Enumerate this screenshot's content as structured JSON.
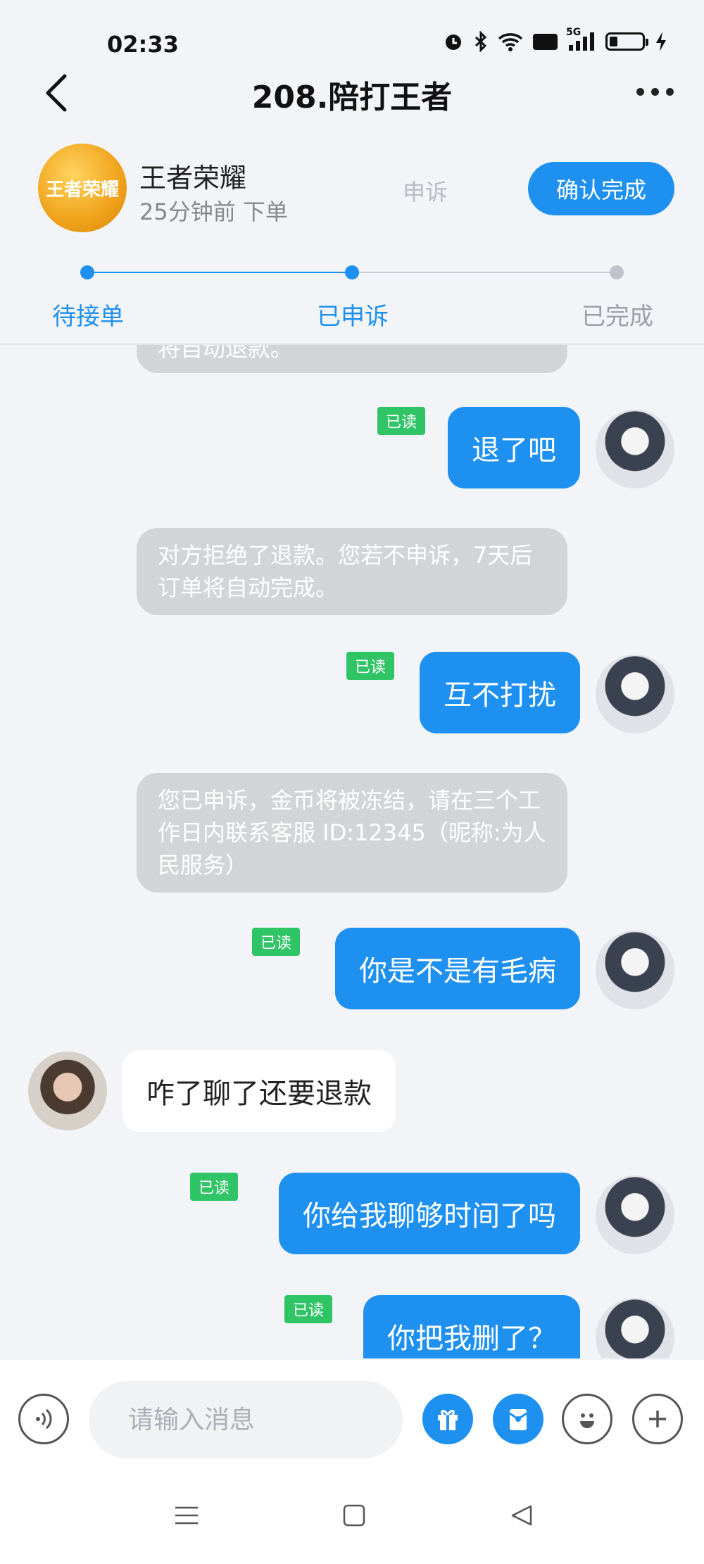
{
  "status_bar": {
    "time": "02:33",
    "icons": [
      "alarm-icon",
      "bluetooth-icon",
      "wifi-icon",
      "hd-icon",
      "signal-5g-icon",
      "battery-icon",
      "charging-icon"
    ],
    "hd_label": "HD",
    "network_label": "5G",
    "battery_level": 0.25
  },
  "header": {
    "title": "208.陪打王者"
  },
  "order": {
    "game_name": "王者荣耀",
    "placed_time": "25分钟前 下单",
    "logo_text": "王者荣耀",
    "appeal_label": "申诉",
    "confirm_label": "确认完成"
  },
  "progress": {
    "steps": [
      {
        "label": "待接单",
        "state": "done"
      },
      {
        "label": "已申诉",
        "state": "current"
      },
      {
        "label": "已完成",
        "state": "pending"
      }
    ],
    "active_color": "#1e90f0",
    "inactive_color": "#9aa0a8"
  },
  "messages": [
    {
      "type": "system",
      "text": "将自动退款。"
    },
    {
      "type": "outgoing",
      "text": "退了吧",
      "read": "已读"
    },
    {
      "type": "system",
      "text": "对方拒绝了退款。您若不申诉，7天后订单将自动完成。"
    },
    {
      "type": "outgoing",
      "text": "互不打扰",
      "read": "已读"
    },
    {
      "type": "system",
      "text": "您已申诉，金币将被冻结，请在三个工作日内联系客服 ID:12345（昵称:为人民服务）"
    },
    {
      "type": "outgoing",
      "text": "你是不是有毛病",
      "read": "已读"
    },
    {
      "type": "incoming",
      "text": "咋了聊了还要退款"
    },
    {
      "type": "outgoing",
      "text": "你给我聊够时间了吗",
      "read": "已读"
    },
    {
      "type": "outgoing",
      "text": "你把我删了？",
      "read": "已读"
    }
  ],
  "input_bar": {
    "placeholder": "请输入消息",
    "buttons": [
      "voice-icon",
      "gift-icon",
      "red-packet-icon",
      "emoji-icon",
      "plus-icon"
    ]
  },
  "system_nav": [
    "menu-icon",
    "home-icon",
    "back-triangle-icon"
  ],
  "colors": {
    "accent": "#1e90f0",
    "read_badge": "#2fc466",
    "background": "#f2f4f8"
  }
}
